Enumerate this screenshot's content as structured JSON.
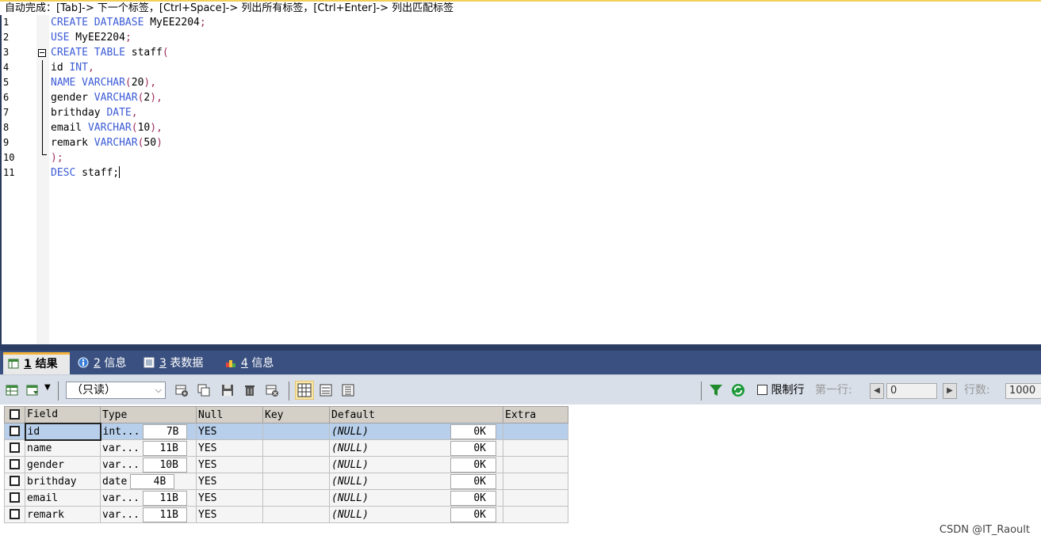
{
  "hint": "自动完成：[Tab]-> 下一个标签，[Ctrl+Space]-> 列出所有标签，[Ctrl+Enter]-> 列出匹配标签",
  "editor": {
    "line_numbers": [
      "1",
      "2",
      "3",
      "4",
      "5",
      "6",
      "7",
      "8",
      "9",
      "10",
      "11"
    ],
    "lines": [
      [
        {
          "t": "CREATE DATABASE",
          "c": "kw"
        },
        {
          "t": " MyEE2204",
          "c": ""
        },
        {
          "t": ";",
          "c": "pun"
        }
      ],
      [
        {
          "t": "USE",
          "c": "kw"
        },
        {
          "t": " MyEE2204",
          "c": ""
        },
        {
          "t": ";",
          "c": "pun"
        }
      ],
      [
        {
          "t": "CREATE TABLE",
          "c": "kw"
        },
        {
          "t": " staff",
          "c": ""
        },
        {
          "t": "(",
          "c": "pun"
        }
      ],
      [
        {
          "t": "id ",
          "c": ""
        },
        {
          "t": "INT",
          "c": "kw"
        },
        {
          "t": ",",
          "c": "pun"
        }
      ],
      [
        {
          "t": "NAME VARCHAR",
          "c": "kw"
        },
        {
          "t": "(",
          "c": "pun"
        },
        {
          "t": "20",
          "c": ""
        },
        {
          "t": "),",
          "c": "pun"
        }
      ],
      [
        {
          "t": "gender ",
          "c": ""
        },
        {
          "t": "VARCHAR",
          "c": "kw"
        },
        {
          "t": "(",
          "c": "pun"
        },
        {
          "t": "2",
          "c": ""
        },
        {
          "t": "),",
          "c": "pun"
        }
      ],
      [
        {
          "t": "brithday ",
          "c": ""
        },
        {
          "t": "DATE",
          "c": "kw"
        },
        {
          "t": ",",
          "c": "pun"
        }
      ],
      [
        {
          "t": "email ",
          "c": ""
        },
        {
          "t": "VARCHAR",
          "c": "kw"
        },
        {
          "t": "(",
          "c": "pun"
        },
        {
          "t": "10",
          "c": ""
        },
        {
          "t": "),",
          "c": "pun"
        }
      ],
      [
        {
          "t": "remark ",
          "c": ""
        },
        {
          "t": "VARCHAR",
          "c": "kw"
        },
        {
          "t": "(",
          "c": "pun"
        },
        {
          "t": "50",
          "c": ""
        },
        {
          "t": ")",
          "c": "pun"
        }
      ],
      [
        {
          "t": ");",
          "c": "pun"
        }
      ],
      [
        {
          "t": "DESC",
          "c": "kw"
        },
        {
          "t": " staff;",
          "c": ""
        }
      ]
    ]
  },
  "tabs": [
    {
      "num": "1",
      "label": "结果",
      "icon": "result-table-icon"
    },
    {
      "num": "2",
      "label": "信息",
      "icon": "info-icon"
    },
    {
      "num": "3",
      "label": "表数据",
      "icon": "table-data-icon"
    },
    {
      "num": "4",
      "label": "信息",
      "icon": "info-chart-icon"
    }
  ],
  "toolbar": {
    "mode_select": "（只读）",
    "limit_label": "限制行",
    "first_row_label": "第一行:",
    "first_row_value": "0",
    "row_count_label": "行数:",
    "row_count_value": "1000"
  },
  "grid": {
    "columns": [
      "Field",
      "Type",
      "Null",
      "Key",
      "Default",
      "Extra"
    ],
    "rows": [
      {
        "field": "id",
        "type": "int...",
        "size": "7B",
        "null": "YES",
        "key": "",
        "default": "(NULL)",
        "dsize": "0K",
        "extra": ""
      },
      {
        "field": "name",
        "type": "var...",
        "size": "11B",
        "null": "YES",
        "key": "",
        "default": "(NULL)",
        "dsize": "0K",
        "extra": ""
      },
      {
        "field": "gender",
        "type": "var...",
        "size": "10B",
        "null": "YES",
        "key": "",
        "default": "(NULL)",
        "dsize": "0K",
        "extra": ""
      },
      {
        "field": "brithday",
        "type": "date",
        "size": "4B",
        "null": "YES",
        "key": "",
        "default": "(NULL)",
        "dsize": "0K",
        "extra": ""
      },
      {
        "field": "email",
        "type": "var...",
        "size": "11B",
        "null": "YES",
        "key": "",
        "default": "(NULL)",
        "dsize": "0K",
        "extra": ""
      },
      {
        "field": "remark",
        "type": "var...",
        "size": "11B",
        "null": "YES",
        "key": "",
        "default": "(NULL)",
        "dsize": "0K",
        "extra": ""
      }
    ]
  },
  "watermark": "CSDN @IT_Raoult",
  "colors": {
    "keyword": "#3b5bd6",
    "punct": "#a03060",
    "tab_bar": "#3a5080",
    "selected_row": "#b7cfeb"
  }
}
